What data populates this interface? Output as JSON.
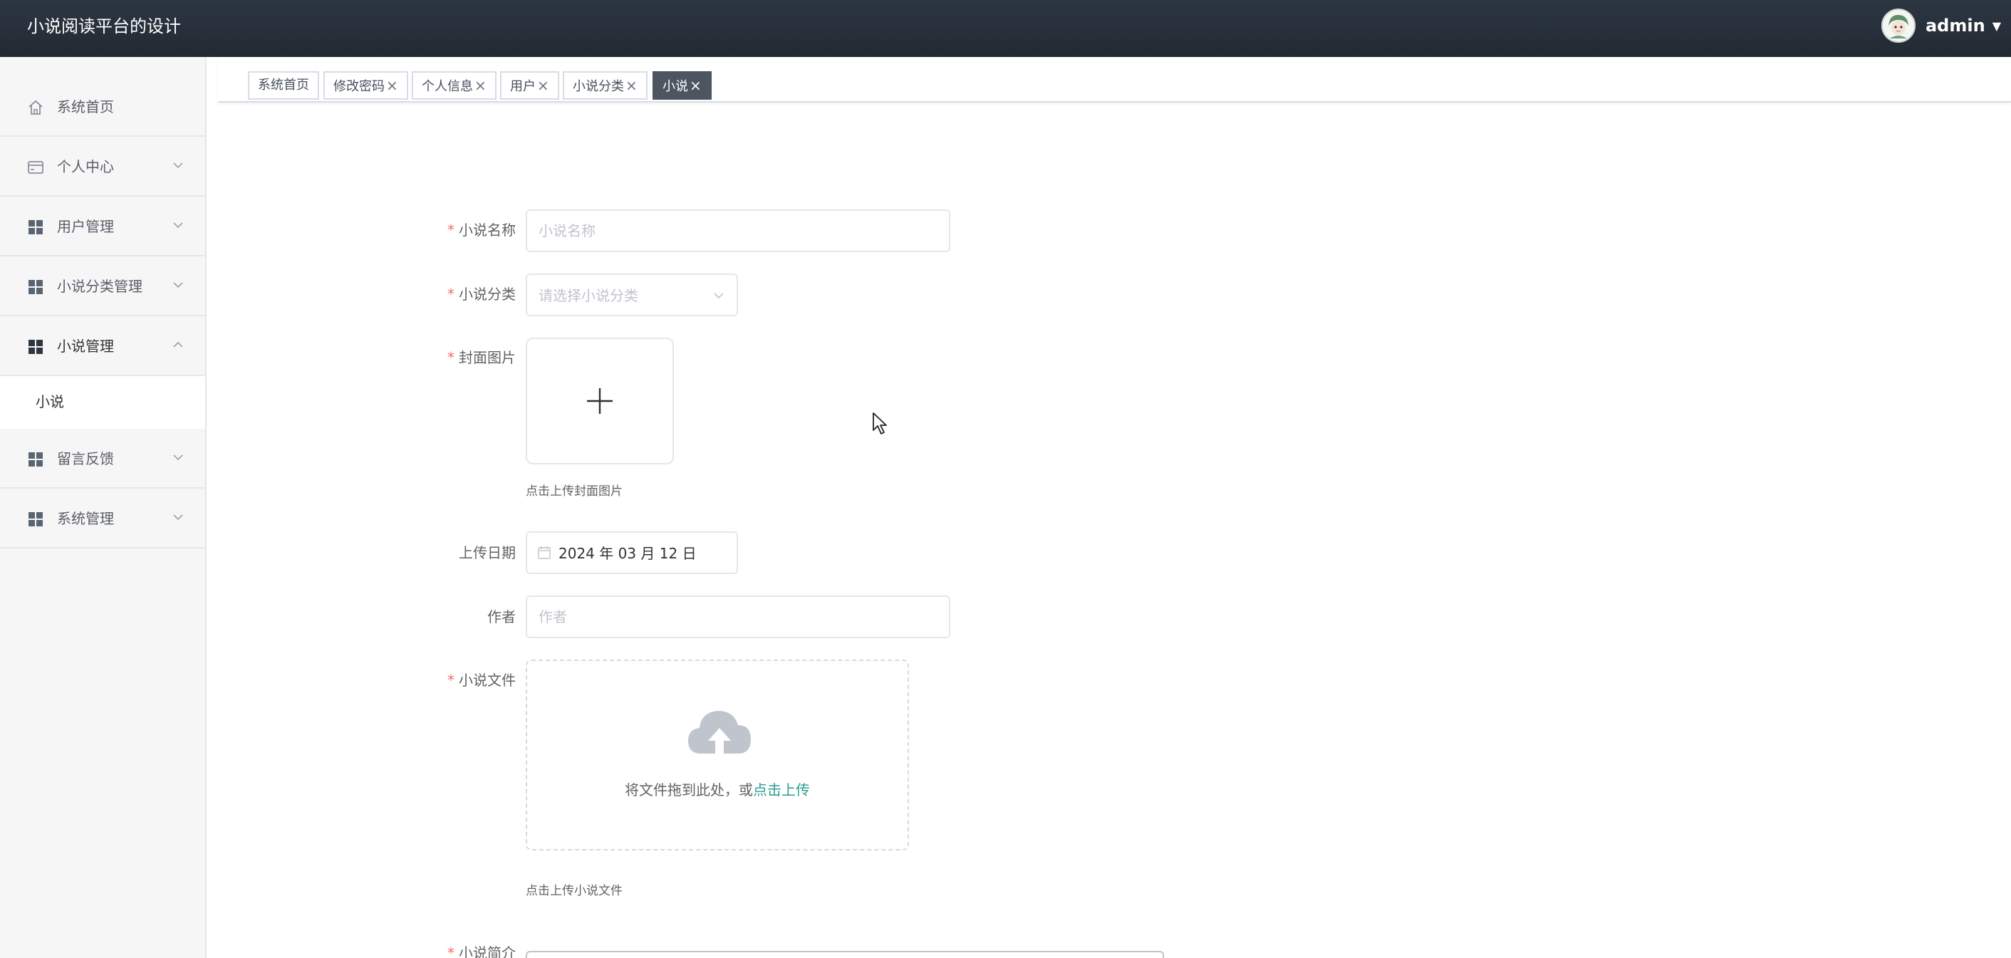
{
  "header": {
    "app_title": "小说阅读平台的设计",
    "username": "admin",
    "caret": "▼"
  },
  "sidebar": {
    "items": [
      {
        "label": "系统首页",
        "icon": "home-icon"
      },
      {
        "label": "个人中心",
        "icon": "card-icon"
      },
      {
        "label": "用户管理",
        "icon": "grid-icon"
      },
      {
        "label": "小说分类管理",
        "icon": "grid-icon"
      },
      {
        "label": "小说管理",
        "icon": "grid-icon",
        "expanded": true
      },
      {
        "label": "留言反馈",
        "icon": "grid-icon"
      },
      {
        "label": "系统管理",
        "icon": "grid-icon"
      }
    ],
    "sub_items": [
      {
        "label": "小说"
      }
    ]
  },
  "tags": [
    {
      "label": "系统首页",
      "closable": false
    },
    {
      "label": "修改密码",
      "closable": true
    },
    {
      "label": "个人信息",
      "closable": true
    },
    {
      "label": "用户",
      "closable": true
    },
    {
      "label": "小说分类",
      "closable": true
    },
    {
      "label": "小说",
      "closable": true,
      "active": true
    }
  ],
  "tag_close_glyph": "×",
  "form": {
    "name": {
      "label": "小说名称",
      "placeholder": "小说名称",
      "value": ""
    },
    "category": {
      "label": "小说分类",
      "placeholder": "请选择小说分类"
    },
    "cover": {
      "label": "封面图片",
      "hint": "点击上传封面图片"
    },
    "upload_date": {
      "label": "上传日期",
      "value": "2024 年 03 月 12 日"
    },
    "author": {
      "label": "作者",
      "placeholder": "作者",
      "value": ""
    },
    "file": {
      "label": "小说文件",
      "drop_text": "将文件拖到此处，或",
      "link_text": "点击上传",
      "hint": "点击上传小说文件"
    },
    "intro": {
      "label": "小说简介"
    }
  },
  "colors": {
    "header_bg": "#2c3642",
    "required": "#f56c6c",
    "link": "#2a9d8f",
    "active_tag_bg": "#4c5560"
  }
}
